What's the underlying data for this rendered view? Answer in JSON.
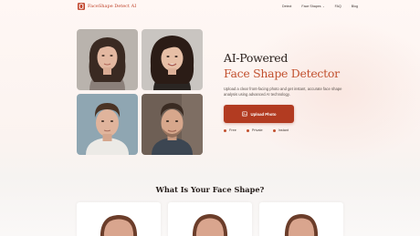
{
  "nav": {
    "brand": "FaceShape Detect AI",
    "links": [
      "Detect",
      "Face Shapes",
      "FAQ",
      "Blog"
    ]
  },
  "hero": {
    "title_line1": "AI-Powered",
    "title_line2": "Face Shape Detector",
    "description": "Upload a clear front-facing photo and get instant, accurate face shape analysis using advanced AI technology.",
    "upload_button": "Upload Photo",
    "badges": [
      "Free",
      "Private",
      "Instant"
    ]
  },
  "section": {
    "title": "What Is Your Face Shape?"
  },
  "colors": {
    "brand": "#c0432a",
    "accent": "#c2512f",
    "button": "#b23b21"
  },
  "icons": {
    "logo": "face-logo-icon",
    "upload": "image-upload-icon",
    "caret": "chevron-down-icon"
  }
}
